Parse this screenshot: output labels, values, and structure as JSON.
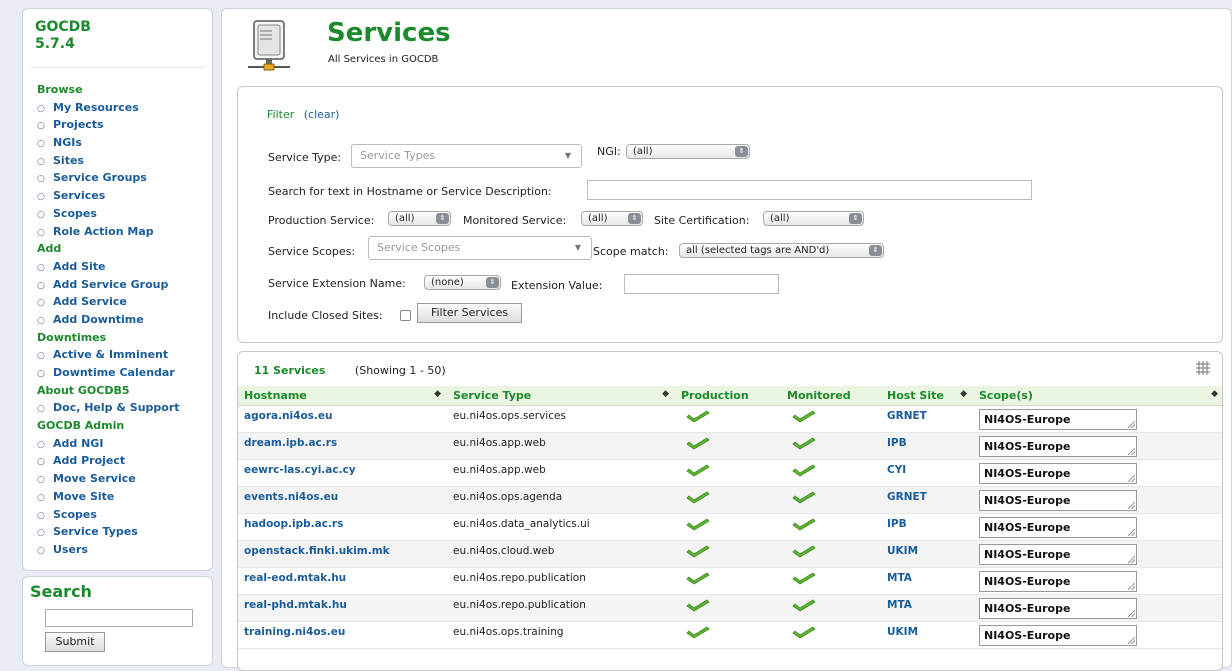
{
  "app": {
    "name_line1": "GOCDB",
    "name_line2": "5.7.4"
  },
  "sidebar": {
    "sections": [
      {
        "heading": "Browse",
        "items": [
          "My Resources",
          "Projects",
          "NGIs",
          "Sites",
          "Service Groups",
          "Services",
          "Scopes",
          "Role Action Map"
        ]
      },
      {
        "heading": "Add",
        "items": [
          "Add Site",
          "Add Service Group",
          "Add Service",
          "Add Downtime"
        ]
      },
      {
        "heading": "Downtimes",
        "items": [
          "Active & Imminent",
          "Downtime Calendar"
        ]
      },
      {
        "heading": "About GOCDB5",
        "items": [
          "Doc, Help & Support"
        ]
      },
      {
        "heading": "GOCDB Admin",
        "items": [
          "Add NGI",
          "Add Project",
          "Move Service",
          "Move Site",
          "Scopes",
          "Service Types",
          "Users"
        ]
      }
    ]
  },
  "search": {
    "title": "Search",
    "value": "",
    "submit_label": "Submit"
  },
  "page": {
    "title": "Services",
    "subtitle": "All Services in GOCDB",
    "icon": "server-icon"
  },
  "filter": {
    "title": "Filter",
    "clear_label": "(clear)",
    "service_type_label": "Service Type:",
    "service_type_placeholder": "Service Types",
    "ngi_label": "NGI:",
    "ngi_value": "(all)",
    "search_text_label": "Search for text in Hostname or Service Description:",
    "search_text_value": "",
    "production_label": "Production Service:",
    "production_value": "(all)",
    "monitored_label": "Monitored Service:",
    "monitored_value": "(all)",
    "certification_label": "Site Certification:",
    "certification_value": "(all)",
    "scopes_label": "Service Scopes:",
    "scopes_placeholder": "Service Scopes",
    "scope_match_label": "Scope match:",
    "scope_match_value": "all (selected tags are AND'd)",
    "extension_name_label": "Service Extension Name:",
    "extension_name_value": "(none)",
    "extension_value_label": "Extension Value:",
    "extension_value": "",
    "include_closed_label": "Include Closed Sites:",
    "include_closed_checked": false,
    "filter_button_label": "Filter Services"
  },
  "results": {
    "count_label": "11 Services",
    "showing_label": "(Showing 1 - 50)",
    "columns": [
      "Hostname",
      "Service Type",
      "Production",
      "Monitored",
      "Host Site",
      "Scope(s)"
    ],
    "rows": [
      {
        "hostname": "agora.ni4os.eu",
        "service_type": "eu.ni4os.ops.services",
        "production": true,
        "monitored": true,
        "site": "GRNET",
        "scope": "NI4OS-Europe"
      },
      {
        "hostname": "dream.ipb.ac.rs",
        "service_type": "eu.ni4os.app.web",
        "production": true,
        "monitored": true,
        "site": "IPB",
        "scope": "NI4OS-Europe"
      },
      {
        "hostname": "eewrc-las.cyi.ac.cy",
        "service_type": "eu.ni4os.app.web",
        "production": true,
        "monitored": true,
        "site": "CYI",
        "scope": "NI4OS-Europe"
      },
      {
        "hostname": "events.ni4os.eu",
        "service_type": "eu.ni4os.ops.agenda",
        "production": true,
        "monitored": true,
        "site": "GRNET",
        "scope": "NI4OS-Europe"
      },
      {
        "hostname": "hadoop.ipb.ac.rs",
        "service_type": "eu.ni4os.data_analytics.ui",
        "production": true,
        "monitored": true,
        "site": "IPB",
        "scope": "NI4OS-Europe"
      },
      {
        "hostname": "openstack.finki.ukim.mk",
        "service_type": "eu.ni4os.cloud.web",
        "production": true,
        "monitored": true,
        "site": "UKIM",
        "scope": "NI4OS-Europe"
      },
      {
        "hostname": "real-eod.mtak.hu",
        "service_type": "eu.ni4os.repo.publication",
        "production": true,
        "monitored": true,
        "site": "MTA",
        "scope": "NI4OS-Europe"
      },
      {
        "hostname": "real-phd.mtak.hu",
        "service_type": "eu.ni4os.repo.publication",
        "production": true,
        "monitored": true,
        "site": "MTA",
        "scope": "NI4OS-Europe"
      },
      {
        "hostname": "training.ni4os.eu",
        "service_type": "eu.ni4os.ops.training",
        "production": true,
        "monitored": true,
        "site": "UKIM",
        "scope": "NI4OS-Europe"
      }
    ]
  },
  "colors": {
    "brand_green": "#1a8a2a",
    "link_blue": "#1a5c99",
    "header_bg": "#e9f4e1",
    "check_green": "#5cb531"
  }
}
